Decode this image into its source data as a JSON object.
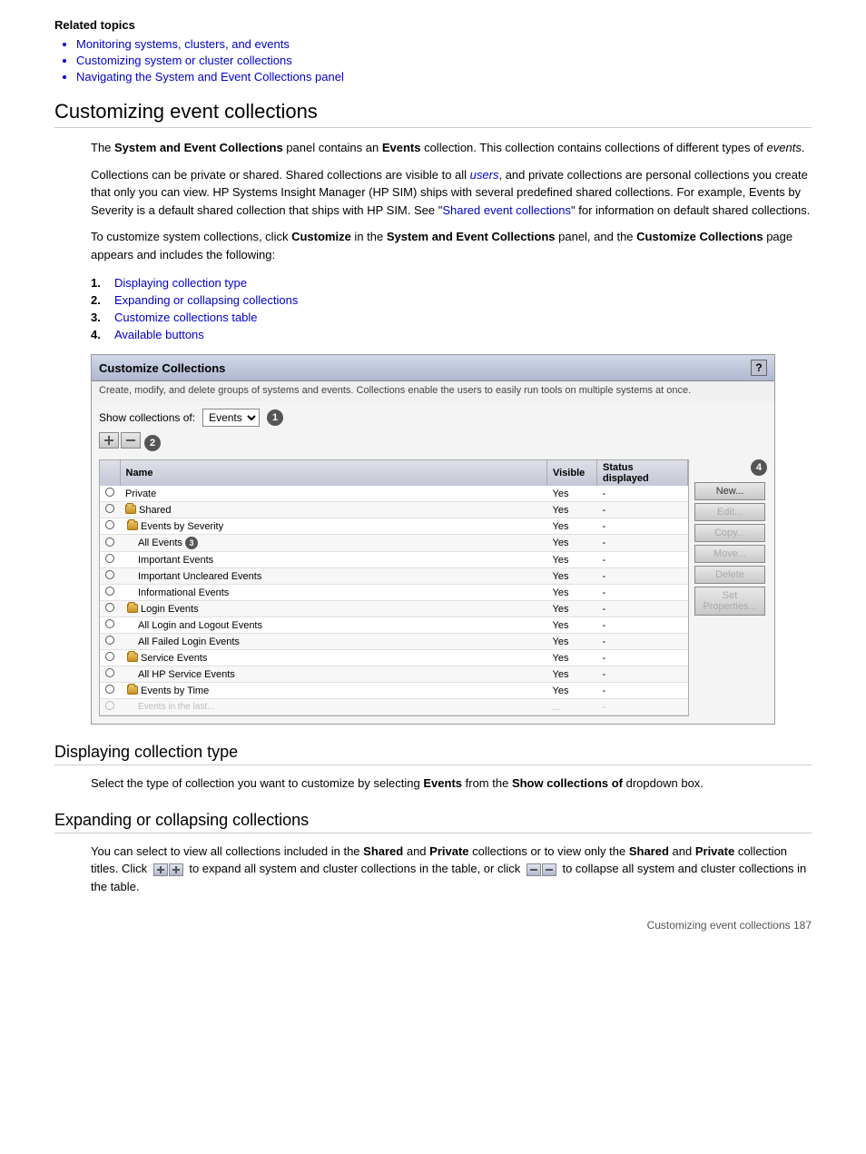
{
  "related_topics": {
    "label": "Related topics",
    "links": [
      "Monitoring systems, clusters, and events",
      "Customizing system or cluster collections",
      "Navigating the System and Event Collections panel"
    ]
  },
  "main_section": {
    "title": "Customizing event collections",
    "paragraphs": [
      "The System and Event Collections panel contains an Events collection. This collection contains collections of different types of events.",
      "Collections can be private or shared. Shared collections are visible to all users, and private collections are personal collections you create that only you can view. HP Systems Insight Manager (HP SIM) ships with several predefined shared collections. For example, Events by Severity is a default shared collection that ships with HP SIM. See \"Shared event collections\" for information on default shared collections.",
      "To customize system collections, click Customize in the System and Event Collections panel, and the Customize Collections page appears and includes the following:"
    ],
    "list_items": [
      {
        "num": "1.",
        "text": "Displaying collection type"
      },
      {
        "num": "2.",
        "text": "Expanding or collapsing collections"
      },
      {
        "num": "3.",
        "text": "Customize collections table"
      },
      {
        "num": "4.",
        "text": "Available buttons"
      }
    ]
  },
  "dialog": {
    "title": "Customize Collections",
    "subtitle": "Create, modify, and delete groups of systems and events. Collections enable the users to easily run tools on multiple systems at once.",
    "help_btn": "?",
    "show_label": "Show collections of:",
    "dropdown_value": "Events",
    "table": {
      "headers": [
        "Name",
        "Visible",
        "Status displayed"
      ],
      "rows": [
        {
          "radio": true,
          "indent": 0,
          "folder": false,
          "name": "Private",
          "visible": "Yes",
          "status": "-"
        },
        {
          "radio": true,
          "indent": 0,
          "folder": true,
          "name": "Shared",
          "visible": "Yes",
          "status": "-"
        },
        {
          "radio": true,
          "indent": 1,
          "folder": true,
          "name": "Events by Severity",
          "visible": "Yes",
          "status": "-"
        },
        {
          "radio": true,
          "indent": 2,
          "folder": false,
          "name": "All Events",
          "visible": "Yes",
          "status": "-"
        },
        {
          "radio": true,
          "indent": 2,
          "folder": false,
          "name": "Important Events",
          "visible": "Yes",
          "status": "-"
        },
        {
          "radio": true,
          "indent": 2,
          "folder": false,
          "name": "Important Uncleared Events",
          "visible": "Yes",
          "status": "-"
        },
        {
          "radio": true,
          "indent": 2,
          "folder": false,
          "name": "Informational Events",
          "visible": "Yes",
          "status": "-"
        },
        {
          "radio": true,
          "indent": 1,
          "folder": true,
          "name": "Login Events",
          "visible": "Yes",
          "status": "-"
        },
        {
          "radio": true,
          "indent": 2,
          "folder": false,
          "name": "All Login and Logout Events",
          "visible": "Yes",
          "status": "-"
        },
        {
          "radio": true,
          "indent": 2,
          "folder": false,
          "name": "All Failed Login Events",
          "visible": "Yes",
          "status": "-"
        },
        {
          "radio": true,
          "indent": 1,
          "folder": true,
          "name": "Service Events",
          "visible": "Yes",
          "status": "-"
        },
        {
          "radio": true,
          "indent": 2,
          "folder": false,
          "name": "All HP Service Events",
          "visible": "Yes",
          "status": "-"
        },
        {
          "radio": true,
          "indent": 1,
          "folder": true,
          "name": "Events by Time",
          "visible": "Yes",
          "status": "-"
        },
        {
          "radio": true,
          "indent": 2,
          "folder": false,
          "name": "Events in the last...",
          "visible": "...",
          "status": "-",
          "truncated": true
        }
      ]
    },
    "buttons": [
      {
        "label": "New...",
        "disabled": false
      },
      {
        "label": "Edit...",
        "disabled": true
      },
      {
        "label": "Copy...",
        "disabled": true
      },
      {
        "label": "Move...",
        "disabled": true
      },
      {
        "label": "Delete",
        "disabled": true
      },
      {
        "label": "Set Properties...",
        "disabled": true
      }
    ]
  },
  "sub_sections": [
    {
      "id": "displaying-collection-type",
      "title": "Displaying collection type",
      "body": "Select the type of collection you want to customize by selecting Events from the Show collections of dropdown box."
    },
    {
      "id": "expanding-collapsing",
      "title": "Expanding or collapsing collections",
      "body_parts": [
        "You can select to view all collections included in the ",
        "Shared",
        " and ",
        "Private",
        " collections or to view only the ",
        "Shared",
        " and ",
        "Private",
        " collection titles. Click ",
        "[expand_icon]",
        " to expand all system and cluster collections in the table, or click ",
        "[collapse_icon]",
        " to collapse all system and cluster collections in the table."
      ]
    }
  ],
  "footer": {
    "text": "Customizing event collections    187"
  }
}
